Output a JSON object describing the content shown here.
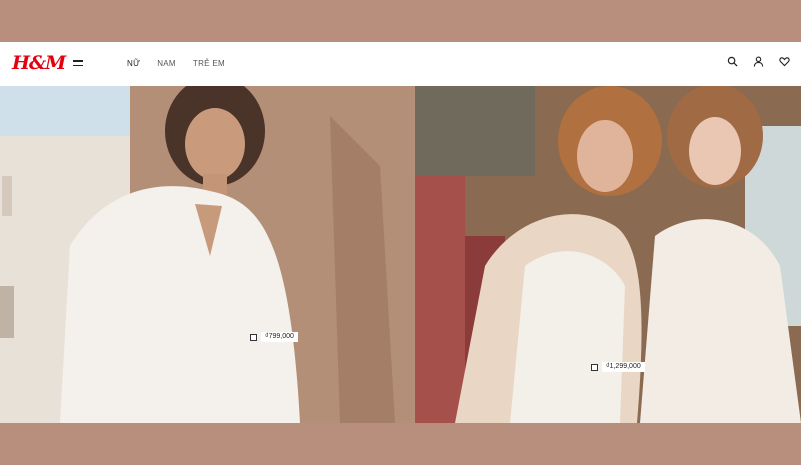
{
  "brand": {
    "logo_text": "H&M",
    "logo_color": "#e50010"
  },
  "nav": {
    "items": [
      {
        "label": "NỮ"
      },
      {
        "label": "NAM"
      },
      {
        "label": "TRẺ EM"
      }
    ]
  },
  "icons": [
    "menu-icon",
    "search-icon",
    "account-icon",
    "heart-icon"
  ],
  "heroes": [
    {
      "price": "₫799,000",
      "marker": "D"
    },
    {
      "price": "₫1,299,000",
      "marker": ""
    }
  ],
  "colors": {
    "page_background": "#b78f7c",
    "header_background": "#ffffff"
  }
}
